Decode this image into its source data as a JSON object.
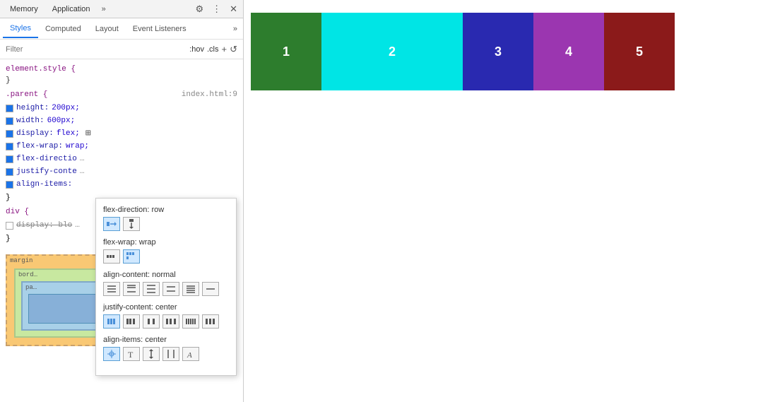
{
  "tabs": {
    "items": [
      {
        "label": "Memory",
        "active": false
      },
      {
        "label": "Application",
        "active": false
      },
      {
        "label": "more",
        "active": false
      }
    ],
    "icons": {
      "settings": "⚙",
      "more": "⋮",
      "close": "✕"
    }
  },
  "sub_tabs": {
    "items": [
      {
        "label": "Styles",
        "active": true
      },
      {
        "label": "Computed",
        "active": false
      },
      {
        "label": "Layout",
        "active": false
      },
      {
        "label": "Event Listeners",
        "active": false
      }
    ]
  },
  "filter": {
    "placeholder": "Filter",
    "hov_label": ":hov",
    "cls_label": ".cls",
    "plus_label": "+",
    "refresh_label": "↺"
  },
  "css_rules": {
    "element_style": {
      "selector": "element.style {",
      "closing": "}"
    },
    "parent_rule": {
      "selector": ".parent {",
      "source": "index.html:9",
      "properties": [
        {
          "prop": "height",
          "value": "200px",
          "checked": true,
          "strikethrough": false
        },
        {
          "prop": "width",
          "value": "600px",
          "checked": true,
          "strikethrough": false
        },
        {
          "prop": "display",
          "value": "flex",
          "checked": true,
          "strikethrough": false,
          "has_icon": true
        },
        {
          "prop": "flex-wrap",
          "value": "wrap",
          "checked": true,
          "strikethrough": false
        },
        {
          "prop": "flex-direction",
          "value": "",
          "checked": true,
          "strikethrough": false,
          "truncated": true
        },
        {
          "prop": "justify-content",
          "value": "",
          "checked": true,
          "strikethrough": false,
          "truncated": true
        },
        {
          "prop": "align-items",
          "value": "",
          "checked": true,
          "strikethrough": false,
          "truncated": true
        }
      ],
      "closing": "}"
    },
    "div_rule": {
      "selector": "div {",
      "properties": [
        {
          "prop": "display",
          "value": "block",
          "checked": false,
          "strikethrough": true,
          "truncated": true
        }
      ],
      "closing": "}"
    }
  },
  "tooltip": {
    "flex_direction": {
      "label": "flex-direction:",
      "value": "row",
      "icons": [
        {
          "name": "row-icon",
          "symbol": "→",
          "active": true
        },
        {
          "name": "row-reverse-icon",
          "symbol": "←",
          "active": false
        }
      ]
    },
    "flex_wrap": {
      "label": "flex-wrap:",
      "value": "wrap",
      "icons": [
        {
          "name": "nowrap-icon",
          "symbol": "⋯",
          "active": false
        },
        {
          "name": "wrap-icon",
          "symbol": "⊞",
          "active": true
        }
      ]
    },
    "align_content": {
      "label": "align-content:",
      "value": "normal",
      "icons": [
        {
          "name": "align-content-1",
          "symbol": "≡"
        },
        {
          "name": "align-content-2",
          "symbol": "≡"
        },
        {
          "name": "align-content-3",
          "symbol": "≡"
        },
        {
          "name": "align-content-4",
          "symbol": "≡"
        },
        {
          "name": "align-content-5",
          "symbol": "≡"
        },
        {
          "name": "align-content-6",
          "symbol": "≡"
        }
      ]
    },
    "justify_content": {
      "label": "justify-content:",
      "value": "center",
      "icons": [
        {
          "name": "justify-1",
          "symbol": "⬛"
        },
        {
          "name": "justify-2",
          "symbol": "⬛"
        },
        {
          "name": "justify-3",
          "symbol": "⬛"
        },
        {
          "name": "justify-4",
          "symbol": "⬛"
        },
        {
          "name": "justify-5",
          "symbol": "⬛"
        },
        {
          "name": "justify-6",
          "symbol": "⬛"
        }
      ]
    },
    "align_items": {
      "label": "align-items:",
      "value": "center",
      "icons": [
        {
          "name": "align-items-1",
          "symbol": "✛"
        },
        {
          "name": "align-items-2",
          "symbol": "T"
        },
        {
          "name": "align-items-3",
          "symbol": "↕"
        },
        {
          "name": "align-items-4",
          "symbol": "‖"
        },
        {
          "name": "align-items-5",
          "symbol": "A"
        }
      ]
    }
  },
  "preview": {
    "flex_items": [
      {
        "label": "1",
        "color": "#2d7d2d"
      },
      {
        "label": "2",
        "color": "#00e5e5"
      },
      {
        "label": "3",
        "color": "#2929b0"
      },
      {
        "label": "4",
        "color": "#9b36b0"
      },
      {
        "label": "5",
        "color": "#8b1a1a"
      }
    ]
  }
}
